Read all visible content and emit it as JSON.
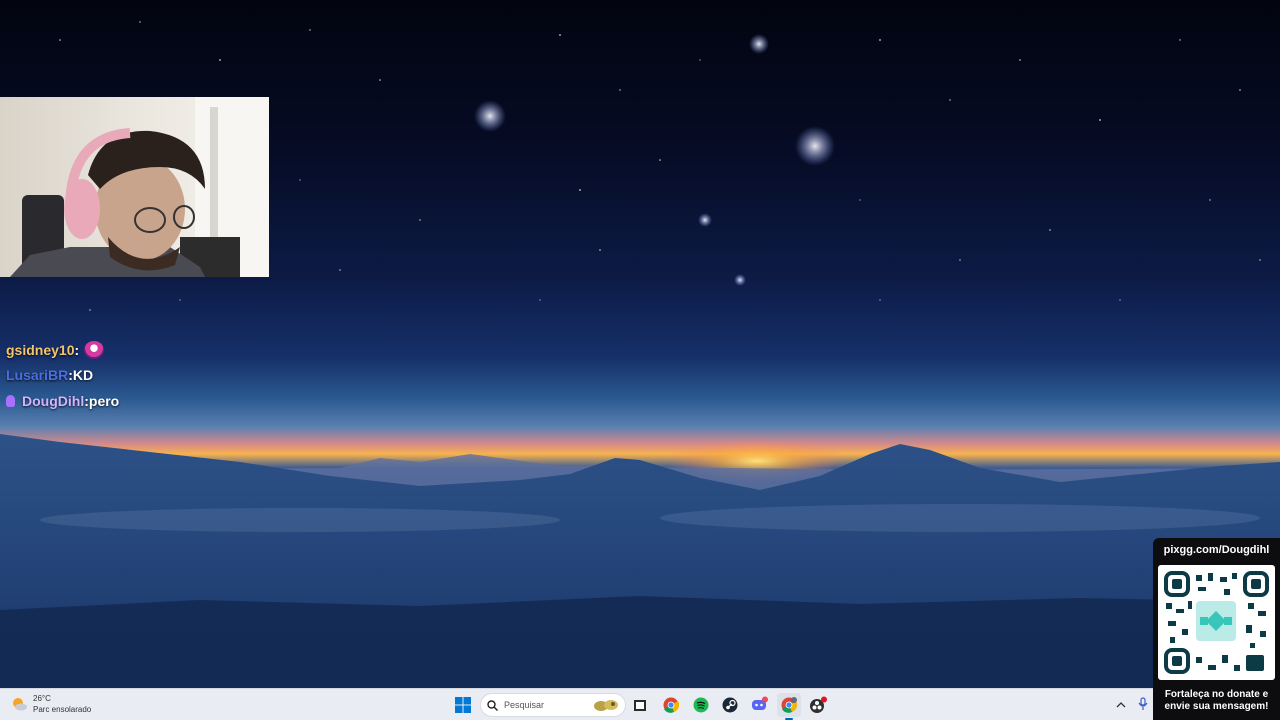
{
  "chat": {
    "messages": [
      {
        "user": "gsidney10",
        "separator": " : ",
        "text": "",
        "user_color": "#f4c56a",
        "has_emote": true,
        "has_badge": false
      },
      {
        "user": "LusariBR",
        "separator": " : ",
        "text": "KD",
        "user_color": "#4a6fe0",
        "has_emote": false,
        "has_badge": false
      },
      {
        "user": "DougDihl",
        "separator": " : ",
        "text": "pero",
        "user_color": "#d3b3ff",
        "has_emote": false,
        "has_badge": true
      }
    ]
  },
  "donation": {
    "url": "pixgg.com/Dougdihl",
    "message": "Fortaleça no donate e envie sua mensagem!"
  },
  "taskbar": {
    "weather": {
      "temp": "26°C",
      "condition": "Parc ensolarado"
    },
    "search": {
      "placeholder": "Pesquisar"
    },
    "apps": [
      {
        "name": "start-button",
        "icon": "windows-logo"
      },
      {
        "name": "file-explorer",
        "icon": "folder-icon"
      },
      {
        "name": "chrome",
        "icon": "chrome-icon"
      },
      {
        "name": "spotify",
        "icon": "spotify-icon"
      },
      {
        "name": "steam",
        "icon": "steam-icon"
      },
      {
        "name": "discord",
        "icon": "discord-icon"
      },
      {
        "name": "chrome-profile",
        "icon": "chrome-icon"
      },
      {
        "name": "obs",
        "icon": "obs-icon"
      }
    ]
  },
  "colors": {
    "taskbar_bg": "#e9ecf2",
    "accent": "#0067c0",
    "donate_bg": "#0d0d0f"
  }
}
